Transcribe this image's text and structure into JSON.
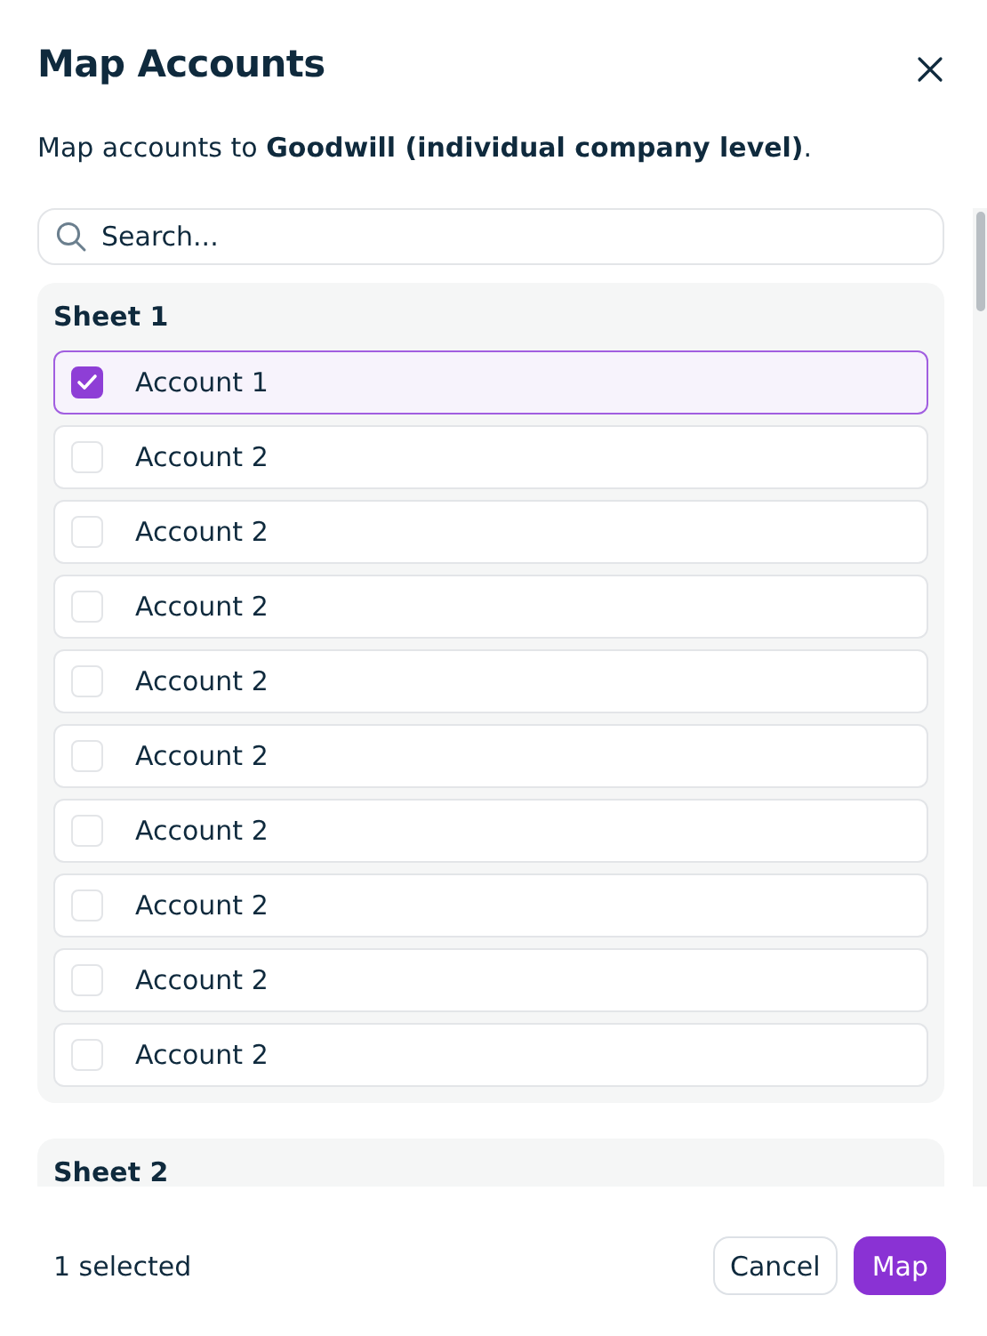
{
  "dialog": {
    "title": "Map Accounts",
    "description": "Map accounts to **Goodwill (individual company level)**."
  },
  "search": {
    "placeholder": "Search..."
  },
  "sheets": [
    {
      "name": "Sheet 1",
      "accounts": [
        {
          "label": "Account 1",
          "checked": true,
          "selected": true
        },
        {
          "label": "Account 2",
          "checked": false,
          "selected": false
        },
        {
          "label": "Account 2",
          "checked": false,
          "selected": false
        },
        {
          "label": "Account 2",
          "checked": false,
          "selected": false
        },
        {
          "label": "Account 2",
          "checked": false,
          "selected": false
        },
        {
          "label": "Account 2",
          "checked": false,
          "selected": false
        },
        {
          "label": "Account 2",
          "checked": false,
          "selected": false
        },
        {
          "label": "Account 2",
          "checked": false,
          "selected": false
        },
        {
          "label": "Account 2",
          "checked": false,
          "selected": false
        },
        {
          "label": "Account 2",
          "checked": false,
          "selected": false
        }
      ]
    },
    {
      "name": "Sheet 2"
    }
  ],
  "footer": {
    "count": "1 selected",
    "buttons": [
      {
        "label": "Cancel",
        "kind": "secondary"
      },
      {
        "label": "Map",
        "kind": "primary"
      }
    ]
  }
}
